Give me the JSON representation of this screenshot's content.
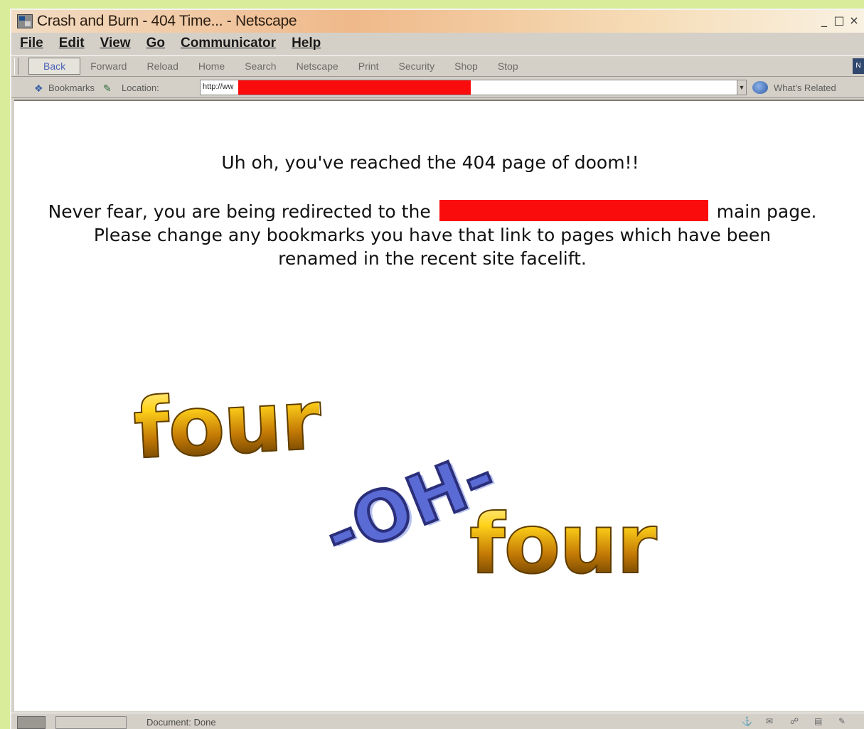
{
  "window": {
    "title": "Crash and Burn - 404 Time... - Netscape",
    "controls": {
      "minimize": "_",
      "maximize": "□",
      "close": "×"
    }
  },
  "menubar": [
    "File",
    "Edit",
    "View",
    "Go",
    "Communicator",
    "Help"
  ],
  "toolbar": {
    "buttons": [
      "Back",
      "Forward",
      "Reload",
      "Home",
      "Search",
      "Netscape",
      "Print",
      "Security",
      "Shop",
      "Stop"
    ]
  },
  "location_bar": {
    "bookmarks_label": "Bookmarks",
    "location_label": "Location:",
    "url_visible": "http://ww",
    "related_label": "What's Related"
  },
  "page": {
    "headline": "Uh oh, you've reached the 404 page of doom!!",
    "redirect_before": "Never fear, you are being redirected to the",
    "redirect_after": "main page.",
    "redirect_line2": "Please change any bookmarks you have that link to pages which have been",
    "redirect_line3": "renamed in the recent site facelift.",
    "logo_word1": "four",
    "logo_word2": "-OH-",
    "logo_word3": "four"
  },
  "statusbar": {
    "text": "Document: Done"
  },
  "colors": {
    "background_frame": "#d8ec9a",
    "redaction": "#fb0c0c",
    "chrome": "#d4d0c8"
  }
}
